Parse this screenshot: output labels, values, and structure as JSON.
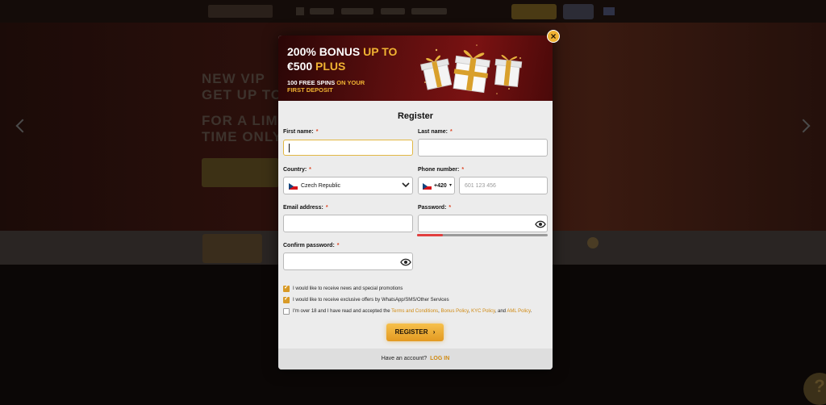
{
  "banner": {
    "title_part1": "200% BONUS ",
    "title_part2": "UP TO",
    "title_part3": "€500 ",
    "title_part4": "PLUS",
    "sub_part1": "100 FREE SPINS ",
    "sub_part2": "ON YOUR",
    "sub_part3": "FIRST DEPOSIT",
    "accent_color": "#f0b232"
  },
  "close_label": "×",
  "form": {
    "title": "Register",
    "first_name": {
      "label": "First name:",
      "required": "*",
      "value": ""
    },
    "last_name": {
      "label": "Last name:",
      "required": "*",
      "value": ""
    },
    "country": {
      "label": "Country:",
      "required": "*",
      "value": "Czech Republic"
    },
    "phone": {
      "label": "Phone number:",
      "required": "*",
      "code": "+420",
      "placeholder": "601 123 456"
    },
    "email": {
      "label": "Email address:",
      "required": "*",
      "value": ""
    },
    "password": {
      "label": "Password:",
      "required": "*",
      "strength": 0.2
    },
    "confirm_password": {
      "label": "Confirm password:",
      "required": "*"
    }
  },
  "consents": [
    {
      "checked": true,
      "text": "I would like to receive news and special promotions"
    },
    {
      "checked": true,
      "text": "I would like to receive exclusive offers by WhatsApp/SMS/Other Services"
    }
  ],
  "terms": {
    "checked": false,
    "prefix": "I'm over 18 and I have read and accepted the ",
    "terms_link": "Terms and Conditions",
    "sep1": ", ",
    "bonus_link": "Bonus Policy",
    "sep2": ", ",
    "kyc_link": "KYC Policy",
    "sep3": ", and ",
    "aml_link": "AML Policy",
    "suffix": "."
  },
  "register_button": "REGISTER",
  "footer": {
    "text": "Have an account?",
    "login": "LOG IN"
  },
  "help_label": "?"
}
